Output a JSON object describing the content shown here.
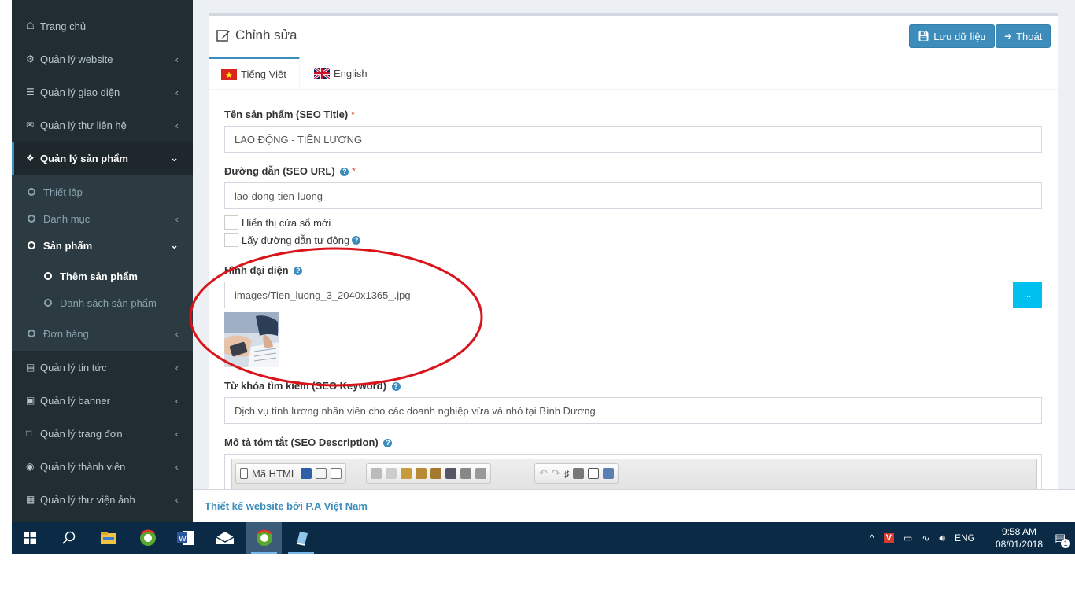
{
  "sidebar": {
    "items": [
      {
        "label": "Trang chủ",
        "icon": "home-icon"
      },
      {
        "label": "Quản lý website",
        "icon": "cogs-icon"
      },
      {
        "label": "Quản lý giao diện",
        "icon": "bars-icon"
      },
      {
        "label": "Quản lý thư liên hệ",
        "icon": "envelope-icon"
      },
      {
        "label": "Quản lý sản phẩm",
        "icon": "cubes-icon"
      },
      {
        "label": "Quản lý tin tức",
        "icon": "newspaper-icon"
      },
      {
        "label": "Quản lý banner",
        "icon": "image-icon"
      },
      {
        "label": "Quản lý trang đơn",
        "icon": "laptop-icon"
      },
      {
        "label": "Quản lý thành viên",
        "icon": "user-circle-icon"
      },
      {
        "label": "Quản lý thư viện ảnh",
        "icon": "gallery-icon"
      }
    ],
    "submenu": {
      "setup": "Thiết lập",
      "category": "Danh mục",
      "products": "Sản phẩm",
      "add_product": "Thêm sản phẩm",
      "product_list": "Danh sách sản phẩm",
      "orders": "Đơn hàng"
    }
  },
  "header": {
    "title": "Chỉnh sửa",
    "save_label": "Lưu dữ liệu",
    "exit_label": "Thoát"
  },
  "tabs": {
    "vi": "Tiếng Việt",
    "en": "English"
  },
  "form": {
    "seo_title_label": "Tên sản phẩm (SEO Title)",
    "seo_title_value": "LAO ĐỘNG - TIỀN LƯƠNG",
    "seo_url_label": "Đường dẫn (SEO URL)",
    "seo_url_value": "lao-dong-tien-luong",
    "new_window_label": "Hiển thị cửa sổ mới",
    "auto_url_label": "Lấy đường dẫn tự động",
    "image_label": "Hình đại diện",
    "image_value": "images/Tien_luong_3_2040x1365_.jpg",
    "browse_label": "...",
    "keyword_label": "Từ khóa tìm kiếm (SEO Keyword)",
    "keyword_value": "Dịch vụ tính lương nhân viên cho các doanh nghiệp vừa và nhỏ tại Bình Dương",
    "description_label": "Mô tả tóm tắt (SEO Description)",
    "required_mark": "*"
  },
  "editor": {
    "source_label": "Mã HTML"
  },
  "footer": {
    "text": "Thiết kế website bởi P.A Việt Nam"
  },
  "taskbar": {
    "language": "ENG",
    "time": "9:58 AM",
    "date": "08/01/2018",
    "notification_count": "1"
  },
  "colors": {
    "sidebar_bg": "#222d32",
    "accent": "#3c8dbc",
    "browse_button": "#00c0ef",
    "annotation": "#d9141b",
    "taskbar_bg": "#0a2a45"
  }
}
